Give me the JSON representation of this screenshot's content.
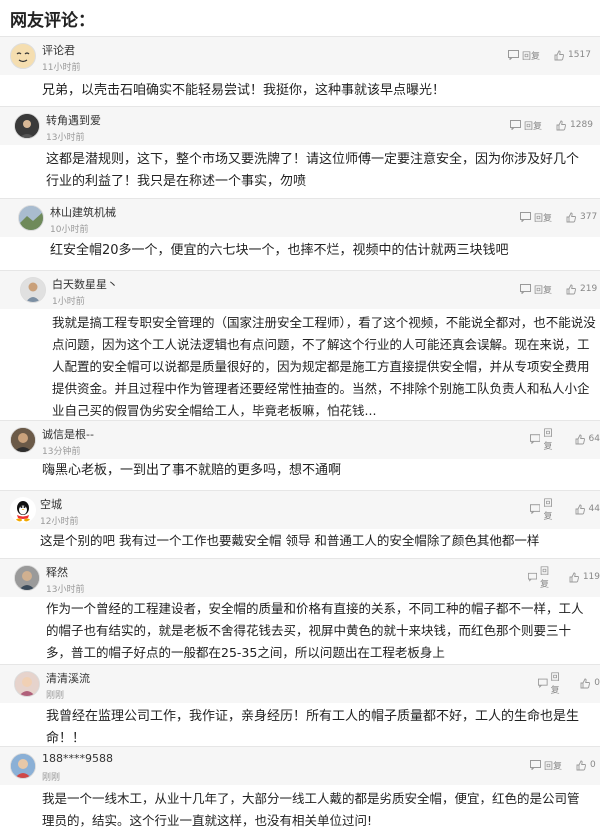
{
  "section_title": "网友评论：",
  "reply_label": "回复",
  "comments": [
    {
      "user": "评论君",
      "time": "11小时前",
      "likes": "1517",
      "text": "兄弟，以壳击石咱确实不能轻易尝试！我挺你，这种事就该早点曝光！"
    },
    {
      "user": "转角遇到爱",
      "time": "13小时前",
      "likes": "1289",
      "text": "这都是潜规则，这下，整个市场又要洗牌了！请这位师傅一定要注意安全，因为你涉及好几个行业的利益了！我只是在称述一个事实，勿喷"
    },
    {
      "user": "林山建筑机械",
      "time": "10小时前",
      "likes": "377",
      "text": "红安全帽20多一个，便宜的六七块一个，也摔不烂，视频中的估计就两三块钱吧"
    },
    {
      "user": "白天数星星丶",
      "time": "1小时前",
      "likes": "219",
      "text": "我就是搞工程专职安全管理的（国家注册安全工程师），看了这个视频，不能说全都对，也不能说没点问题，因为这个工人说法逻辑也有点问题，不了解这个行业的人可能还真会误解。现在来说，工人配置的安全帽可以说都是质量很好的，因为规定都是施工方直接提供安全帽，并从专项安全费用提供资金。并且过程中作为管理者还要经常性抽查的。当然，不排除个别施工队负责人和私人小企业自己买的假冒伪劣安全帽给工人，毕竟老板嘛，怕花钱..."
    },
    {
      "user": "诚信是根--",
      "time": "13分钟前",
      "likes": "64",
      "text": "嗨黑心老板，一到出了事不就赔的更多吗，想不通啊"
    },
    {
      "user": "空城",
      "time": "12小时前",
      "likes": "44",
      "text": "这是个别的吧 我有过一个工作也要戴安全帽 领导 和普通工人的安全帽除了颜色其他都一样"
    },
    {
      "user": "释然",
      "time": "13小时前",
      "likes": "119",
      "text": "作为一个曾经的工程建设者，安全帽的质量和价格有直接的关系，不同工种的帽子都不一样，工人的帽子也有结实的，就是老板不舍得花钱去买，视屏中黄色的就十来块钱，而红色那个则要三十多，普工的帽子好点的一般都在25-35之间，所以问题出在工程老板身上"
    },
    {
      "user": "清清溪流",
      "time": "刚刚",
      "likes": "0",
      "text": "我曾经在监理公司工作，我作证，亲身经历！所有工人的帽子质量都不好，工人的生命也是生命！！"
    },
    {
      "user": "188****9588",
      "time": "刚刚",
      "likes": "0",
      "text": "我是一个一线木工，从业十几年了，大部分一线工人戴的都是劣质安全帽，便宜，红色的是公司管理员的，结实。这个行业一直就这样，也没有相关单位过问!"
    }
  ]
}
